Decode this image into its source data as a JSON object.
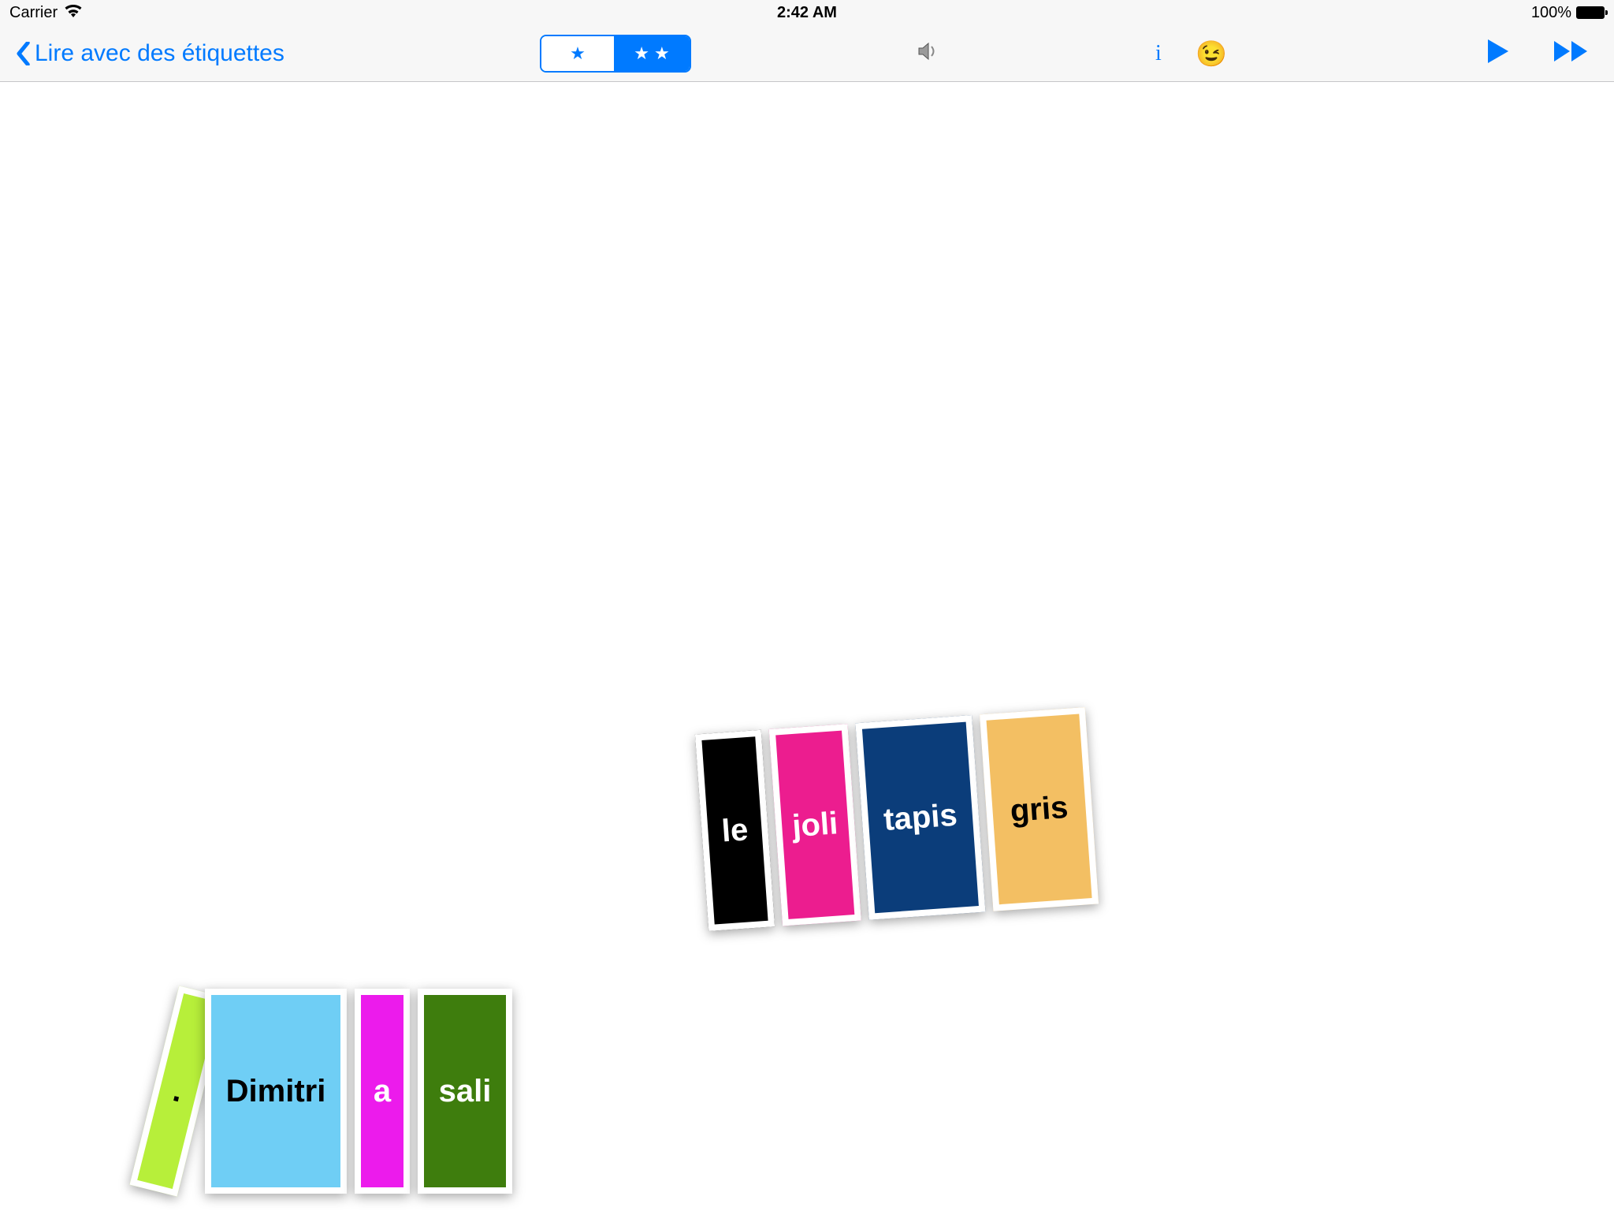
{
  "status_bar": {
    "carrier": "Carrier",
    "time": "2:42 AM",
    "battery_pct": "100%"
  },
  "nav": {
    "back_label": "Lire avec des étiquettes",
    "seg1": "★",
    "seg2": "★ ★",
    "info_label": "i",
    "emoji": "😉"
  },
  "tiles": {
    "group_a": {
      "t1": "le",
      "t2": "joli",
      "t3": "tapis",
      "t4": "gris"
    },
    "group_b": {
      "t0": ".",
      "t1": "Dimitri",
      "t2": "a",
      "t3": "sali"
    }
  },
  "colors": {
    "accent": "#007aff"
  }
}
